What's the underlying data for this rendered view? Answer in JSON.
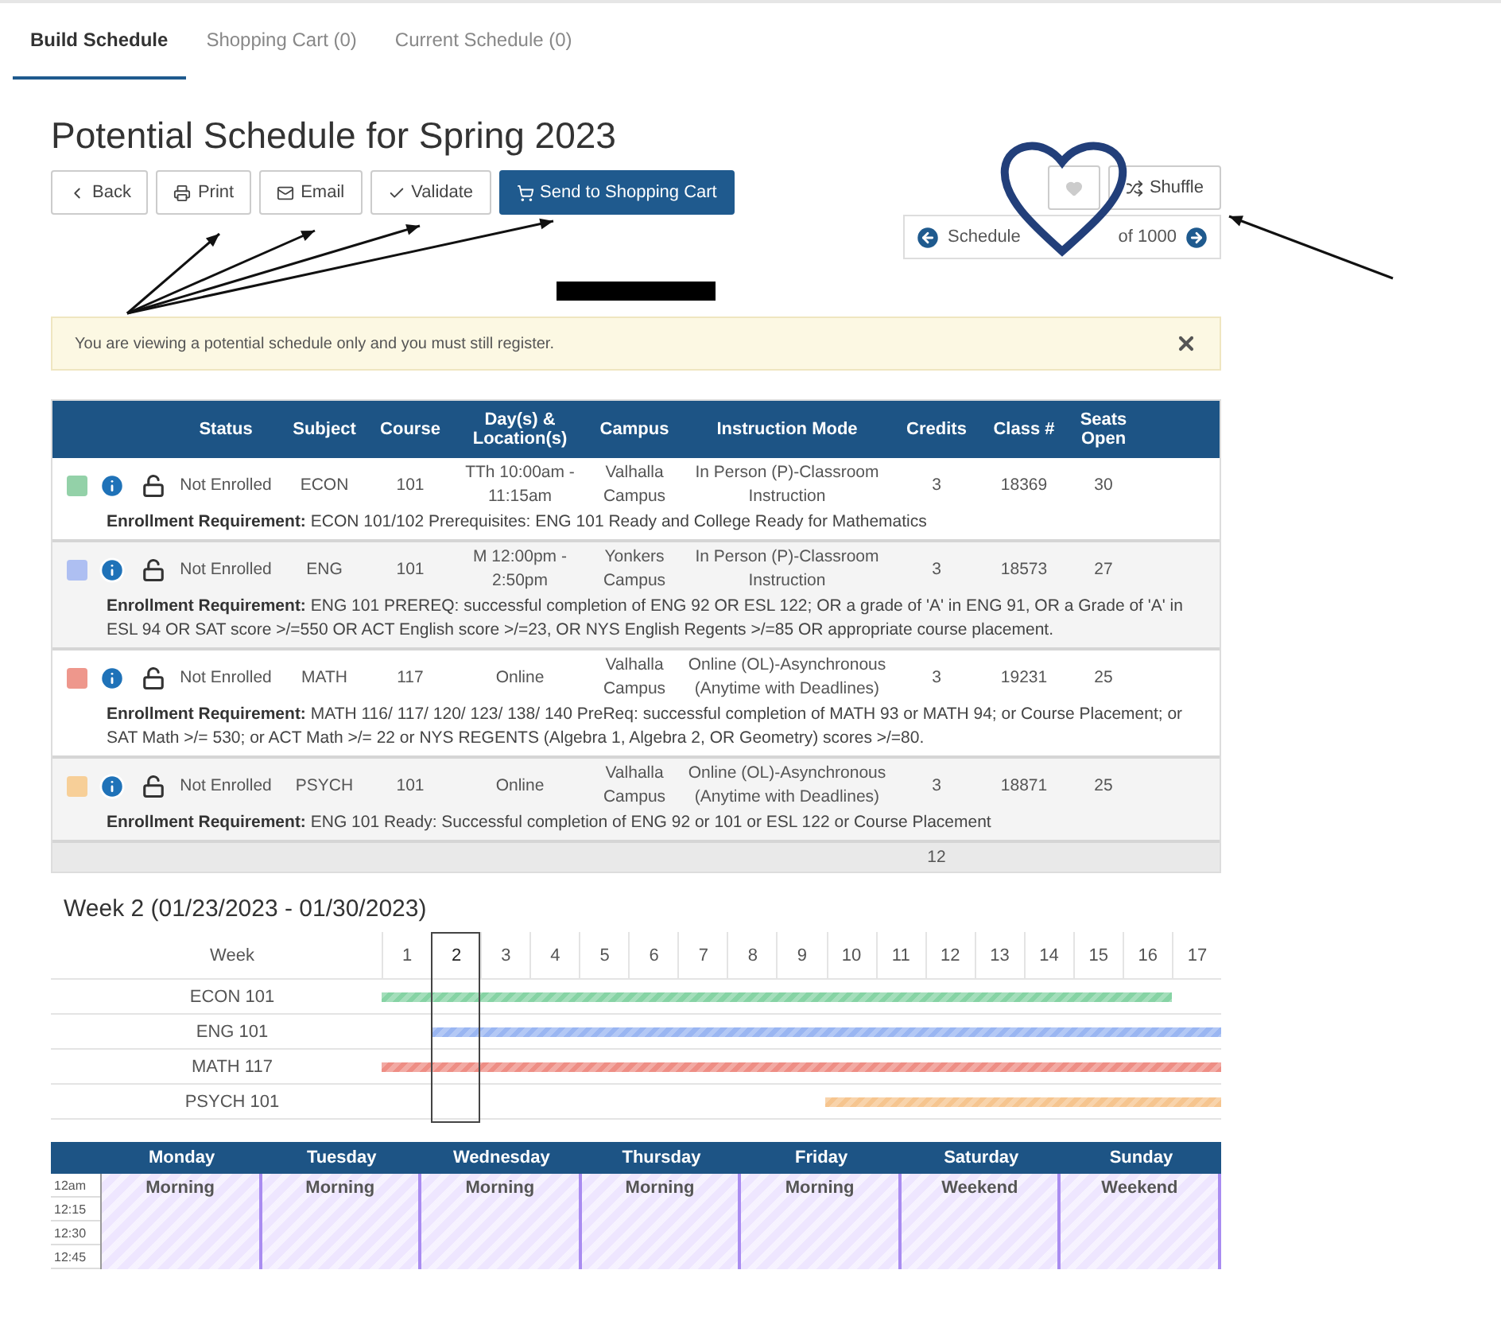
{
  "tabs": [
    {
      "label": "Build Schedule",
      "selected": true
    },
    {
      "label": "Shopping Cart (0)",
      "selected": false
    },
    {
      "label": "Current Schedule (0)",
      "selected": false
    }
  ],
  "title": "Potential Schedule for Spring 2023",
  "toolbar": [
    {
      "kind": "back",
      "label": "Back"
    },
    {
      "kind": "print",
      "label": "Print"
    },
    {
      "kind": "email",
      "label": "Email"
    },
    {
      "kind": "validate",
      "label": "Validate"
    },
    {
      "kind": "cart",
      "label": "Send to Shopping Cart"
    }
  ],
  "shuffle": {
    "label": "Shuffle"
  },
  "schedule_nav": {
    "label": "Schedule",
    "count": "of 1000"
  },
  "alert": {
    "text": "You are viewing a potential schedule only and you must still register."
  },
  "table": {
    "columns": [
      "Status",
      "Subject",
      "Course",
      "Day(s) & Location(s)",
      "Campus",
      "Instruction Mode",
      "Credits",
      "Class #",
      "Seats Open"
    ],
    "rows": [
      {
        "color": "#93d1a8",
        "status": "Not Enrolled",
        "subject": "ECON",
        "course": "101",
        "days": "TTh 10:00am - 11:15am",
        "campus": "Valhalla Campus",
        "mode": "In Person (P)-Classroom Instruction",
        "credits": "3",
        "class": "18369",
        "seats": "30",
        "requirement": "**Enrollment Requirement:** ECON 101/102 Prerequisites: ENG 101 Ready and College Ready for Mathematics"
      },
      {
        "color": "#aebff2",
        "status": "Not Enrolled",
        "subject": "ENG",
        "course": "101",
        "days": "M 12:00pm - 2:50pm",
        "campus": "Yonkers Campus",
        "mode": "In Person (P)-Classroom Instruction",
        "credits": "3",
        "class": "18573",
        "seats": "27",
        "requirement": "**Enrollment Requirement:** ENG 101 PREREQ: successful completion of ENG 92 OR ESL 122; OR a grade of 'A' in ENG 91, OR a Grade of 'A' in ESL 94 OR SAT score >/=550 OR ACT English score >/=23, OR NYS English Regents >/=85 OR appropriate course placement."
      },
      {
        "color": "#ee978c",
        "status": "Not Enrolled",
        "subject": "MATH",
        "course": "117",
        "days": "Online",
        "campus": "Valhalla Campus",
        "mode": "Online (OL)-Asynchronous (Anytime with Deadlines)",
        "credits": "3",
        "class": "19231",
        "seats": "25",
        "requirement": "**Enrollment Requirement:** MATH 116/ 117/ 120/ 123/ 138/ 140 PreReq: successful completion of MATH 93 or MATH 94; or Course Placement; or SAT Math >/= 530; or ACT Math >/= 22 or NYS REGENTS (Algebra 1, Algebra 2, OR Geometry) scores >/=80."
      },
      {
        "color": "#f7cf98",
        "status": "Not Enrolled",
        "subject": "PSYCH",
        "course": "101",
        "days": "Online",
        "campus": "Valhalla Campus",
        "mode": "Online (OL)-Asynchronous (Anytime with Deadlines)",
        "credits": "3",
        "class": "18871",
        "seats": "25",
        "requirement": "**Enrollment Requirement:** ENG 101 Ready: Successful completion of ENG 92 or 101 or ESL 122 or Course Placement"
      }
    ],
    "total_credits": "12"
  },
  "weeks_view": {
    "title": "Week 2 (01/23/2023 - 01/30/2023)",
    "header": "Week",
    "weeks": [
      {
        "label": "1",
        "selected": false
      },
      {
        "label": "2",
        "selected": true
      },
      {
        "label": "3",
        "selected": false
      },
      {
        "label": "4",
        "selected": false
      },
      {
        "label": "5",
        "selected": false
      },
      {
        "label": "6",
        "selected": false
      },
      {
        "label": "7",
        "selected": false
      },
      {
        "label": "8",
        "selected": false
      },
      {
        "label": "9",
        "selected": false
      },
      {
        "label": "10",
        "selected": false
      },
      {
        "label": "11",
        "selected": false
      },
      {
        "label": "12",
        "selected": false
      },
      {
        "label": "13",
        "selected": false
      },
      {
        "label": "14",
        "selected": false
      },
      {
        "label": "15",
        "selected": false
      },
      {
        "label": "16",
        "selected": false
      },
      {
        "label": "17",
        "selected": false
      }
    ],
    "courses": [
      {
        "label": "ECON 101",
        "color": "#86d3a4",
        "kind": "leading",
        "level": 0.941
      },
      {
        "label": "ENG 101",
        "color": "#9ab6f2",
        "kind": "trailing",
        "level": 0.941
      },
      {
        "label": "MATH 117",
        "color": "#ee8e85",
        "kind": "leading",
        "level": 1
      },
      {
        "label": "PSYCH 101",
        "color": "#f6c58f",
        "kind": "trailing",
        "level": 0.471
      }
    ]
  },
  "calendar": {
    "days": [
      {
        "label": "Monday",
        "block": "Morning"
      },
      {
        "label": "Tuesday",
        "block": "Morning"
      },
      {
        "label": "Wednesday",
        "block": "Morning"
      },
      {
        "label": "Thursday",
        "block": "Morning"
      },
      {
        "label": "Friday",
        "block": "Morning"
      },
      {
        "label": "Saturday",
        "block": "Weekend"
      },
      {
        "label": "Sunday",
        "block": "Weekend"
      }
    ],
    "times": [
      "12am",
      "12:15",
      "12:30",
      "12:45"
    ]
  }
}
